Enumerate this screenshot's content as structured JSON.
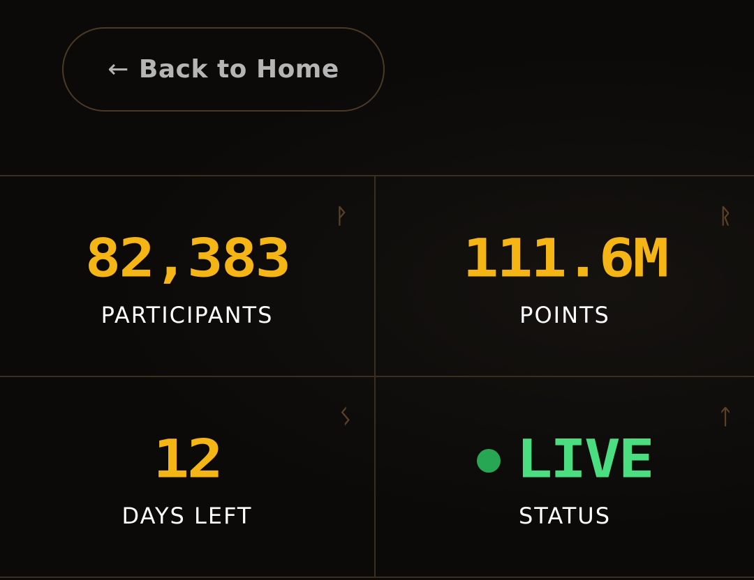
{
  "back_button": {
    "arrow": "←",
    "label": "Back to Home"
  },
  "stats": [
    {
      "value": "82,383",
      "label": "PARTICIPANTS",
      "rune": "ᚹ"
    },
    {
      "value": "111.6M",
      "label": "POINTS",
      "rune": "ᚱ"
    },
    {
      "value": "12",
      "label": "DAYS LEFT",
      "rune": "ᛊ"
    },
    {
      "value": "LIVE",
      "label": "STATUS",
      "rune": "ᛏ"
    }
  ],
  "colors": {
    "accent": "#f5b514",
    "live": "#4ade80",
    "live_dot": "#27a653",
    "border": "#3c2e1d",
    "background": "#0b0a09"
  }
}
